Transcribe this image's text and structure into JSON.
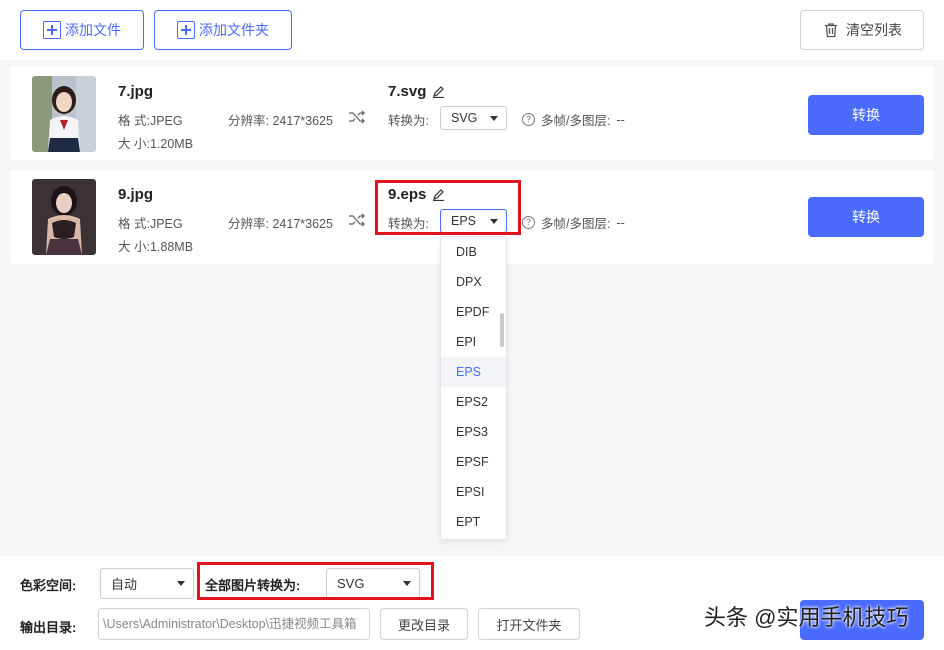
{
  "toolbar": {
    "add_file_label": "添加文件",
    "add_folder_label": "添加文件夹",
    "clear_list_label": "清空列表"
  },
  "labels": {
    "format_label": "格 式:",
    "size_label": "大 小:",
    "resolution_label": "分辨率:",
    "convert_to_label": "转换为:",
    "multiframe_label": "多帧/多图层:",
    "convert_button": "转换"
  },
  "files": [
    {
      "name": "7.jpg",
      "format": "JPEG",
      "resolution": "2417*3625",
      "size": "1.20MB",
      "output_name": "7.svg",
      "target_format": "SVG",
      "multiframe": "--"
    },
    {
      "name": "9.jpg",
      "format": "JPEG",
      "resolution": "2417*3625",
      "size": "1.88MB",
      "output_name": "9.eps",
      "target_format": "EPS",
      "multiframe": "--"
    }
  ],
  "dropdown": {
    "options": [
      "DIB",
      "DPX",
      "EPDF",
      "EPI",
      "EPS",
      "EPS2",
      "EPS3",
      "EPSF",
      "EPSI",
      "EPT"
    ],
    "selected": "EPS"
  },
  "bottom": {
    "color_space_label": "色彩空间:",
    "color_space_value": "自动",
    "convert_all_label": "全部图片转换为:",
    "convert_all_value": "SVG",
    "output_dir_label": "输出目录:",
    "output_dir_value": "\\Users\\Administrator\\Desktop\\迅捷视频工具箱",
    "change_dir_label": "更改目录",
    "open_folder_label": "打开文件夹"
  },
  "watermark": "头条 @实用手机技巧",
  "colors": {
    "accent": "#4b6bff",
    "highlight_box": "#e0141e"
  }
}
